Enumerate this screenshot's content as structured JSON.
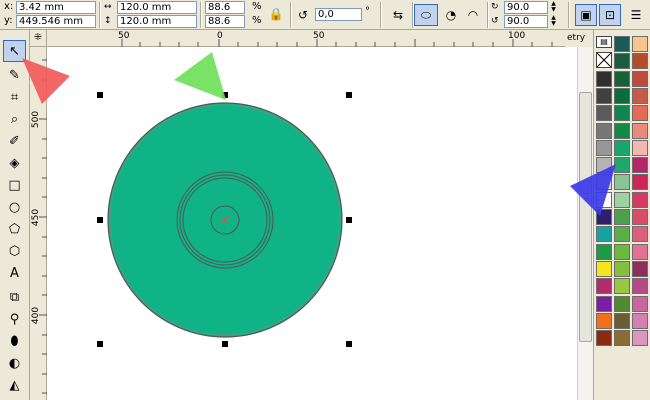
{
  "propbar": {
    "x_label": "x:",
    "x_value": "3.42 mm",
    "y_label": "y:",
    "y_value": "449.546 mm",
    "width_value": "120.0 mm",
    "height_value": "120.0 mm",
    "scale_w": "88.6",
    "scale_h": "88.6",
    "percent": "%",
    "rotation": "0,0",
    "angle_start": "90.0",
    "angle_end": "90.0"
  },
  "ruler": {
    "h_ticks": [
      "50",
      "0",
      "50",
      "100"
    ],
    "v_ticks": [
      "500",
      "450",
      "400"
    ]
  },
  "docker_tab": "etry",
  "palette": {
    "col1": [
      "#000000",
      "#1e1e1e",
      "#2f2f2f",
      "#414141",
      "#5a5a5a",
      "#777777",
      "#979797",
      "#b4b4b4",
      "#d6d6d6",
      "#ffffff",
      "#2e1e6e",
      "#16a2a2",
      "#1b9b45",
      "#f2e61c",
      "#b32b6b",
      "#7c1fa4",
      "#f07119",
      "#8b2a10"
    ],
    "col2": [
      "#1b5b55",
      "#175e3d",
      "#176137",
      "#0a6d3f",
      "#0f8550",
      "#118a43",
      "#14a86a",
      "#1fa86c",
      "#88c596",
      "#9cd3a1",
      "#4aa14e",
      "#59b049",
      "#6bb93a",
      "#83c13d",
      "#9ac841",
      "#4f8b2e",
      "#6a5d33",
      "#8a6c33"
    ],
    "col3": [
      "#f6c68d",
      "#b54d2b",
      "#c04a3c",
      "#c65a48",
      "#e66a57",
      "#e88b7c",
      "#f1b7ad",
      "#b6246b",
      "#cf2557",
      "#d43a62",
      "#d94d6a",
      "#de5f7d",
      "#e27293",
      "#8e2f5b",
      "#b74986",
      "#c864a0",
      "#d47fb2",
      "#dc97c1"
    ]
  }
}
